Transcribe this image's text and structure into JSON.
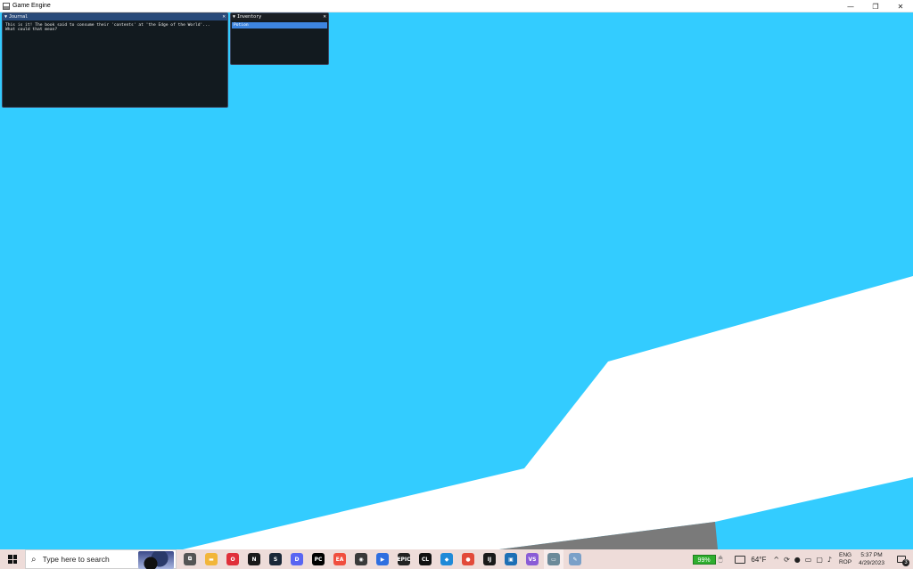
{
  "window": {
    "title": "Game Engine",
    "controls": [
      "—",
      "❐",
      "✕"
    ]
  },
  "journal": {
    "title": "Journal",
    "text": "This is it! The book said to consume their 'contents' at 'the Edge of the World'...\nWhat could that mean?"
  },
  "inventory": {
    "title": "Inventory",
    "items": [
      "Potion"
    ]
  },
  "taskbar": {
    "search_placeholder": "Type here to search",
    "pinned_icons": [
      {
        "name": "task-view-icon",
        "glyph": "⧉",
        "color": "#555555"
      },
      {
        "name": "file-explorer-icon",
        "glyph": "▬",
        "color": "#f2b63a"
      },
      {
        "name": "opera-icon",
        "glyph": "O",
        "color": "#e0303a"
      },
      {
        "name": "nvidia-icon",
        "glyph": "N",
        "color": "#1a1a1a"
      },
      {
        "name": "steam-icon",
        "glyph": "S",
        "color": "#1b2838"
      },
      {
        "name": "discord-icon",
        "glyph": "D",
        "color": "#5865f2"
      },
      {
        "name": "pycharm-icon",
        "glyph": "PC",
        "color": "#000000"
      },
      {
        "name": "ea-icon",
        "glyph": "EA",
        "color": "#f04e3e"
      },
      {
        "name": "obs-icon",
        "glyph": "◉",
        "color": "#3a3a3a"
      },
      {
        "name": "bluestacks-icon",
        "glyph": "▶",
        "color": "#2f6fe0"
      },
      {
        "name": "epic-games-icon",
        "glyph": "EPIC",
        "color": "#222222"
      },
      {
        "name": "clion-icon",
        "glyph": "CL",
        "color": "#111111"
      },
      {
        "name": "vscode-icon",
        "glyph": "◆",
        "color": "#1f8ad8"
      },
      {
        "name": "chrome-icon",
        "glyph": "●",
        "color": "#e24a3a"
      },
      {
        "name": "intellij-icon",
        "glyph": "IJ",
        "color": "#1a1a1a"
      },
      {
        "name": "game-engine-app-icon",
        "glyph": "▣",
        "color": "#1e6fb5"
      },
      {
        "name": "visual-studio-icon",
        "glyph": "VS",
        "color": "#8a5cd6"
      },
      {
        "name": "running-app-icon",
        "glyph": "▭",
        "color": "#6c8a99"
      },
      {
        "name": "paint-icon",
        "glyph": "✎",
        "color": "#7aa0c8"
      }
    ],
    "battery": "99%",
    "temperature": "64°F",
    "language_line1": "ENG",
    "language_line2": "ROP",
    "time": "5:37 PM",
    "date": "4/29/2023",
    "notification_count": "3"
  }
}
